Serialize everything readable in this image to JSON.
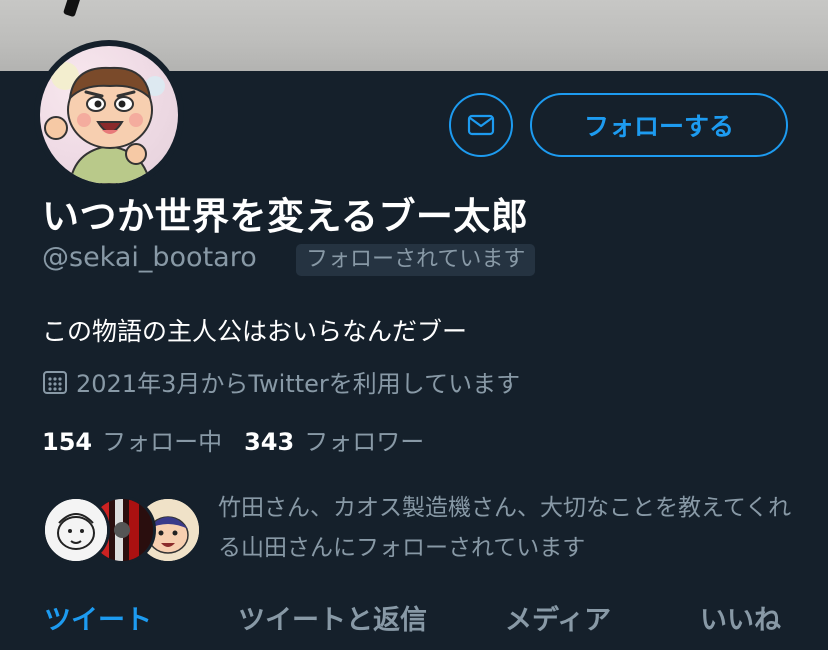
{
  "profile": {
    "display_name": "いつか世界を変えるブー太郎",
    "handle": "@sekai_bootaro",
    "follows_you": "フォローされています",
    "bio": "この物語の主人公はおいらなんだブー",
    "joined": "2021年3月からTwitterを利用しています"
  },
  "actions": {
    "message_icon": "mail-icon",
    "follow_label": "フォローする"
  },
  "stats": {
    "following_count": "154",
    "following_label": "フォロー中",
    "followers_count": "343",
    "followers_label": "フォロワー"
  },
  "followed_by": {
    "text": "竹田さん、カオス製造機さん、大切なことを教えてくれる山田さんにフォローされています"
  },
  "tabs": [
    {
      "label": "ツイート",
      "active": true
    },
    {
      "label": "ツイートと返信",
      "active": false
    },
    {
      "label": "メディア",
      "active": false
    },
    {
      "label": "いいね",
      "active": false
    }
  ],
  "colors": {
    "background": "#15202b",
    "accent": "#1d9bf0",
    "secondary_text": "#8899a6"
  }
}
